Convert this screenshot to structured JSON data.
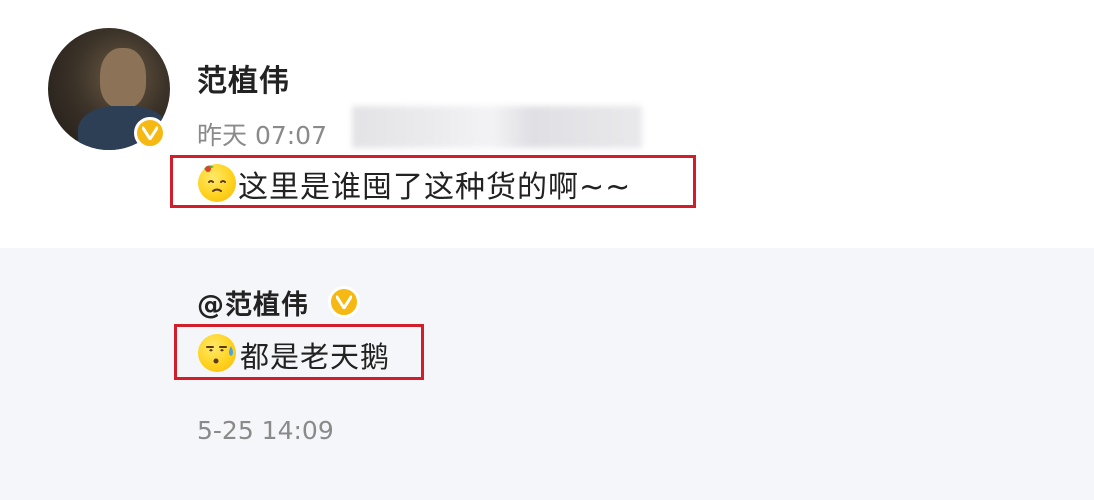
{
  "post": {
    "username": "范植伟",
    "time": "昨天 07:07",
    "text": "这里是谁囤了这种货的啊~~",
    "emoji_icon": "sour-lemon-face-emoji",
    "verified_icon": "verified-v-badge-icon"
  },
  "repost": {
    "username": "@范植伟",
    "text": "都是老天鹅",
    "emoji_icon": "sweat-face-emoji",
    "time": "5-25 14:09"
  },
  "colors": {
    "highlight": "#d21d2a",
    "verified_badge": "#f6b914",
    "meta_text": "#8a8a8a",
    "repost_background": "#f5f6fa"
  }
}
